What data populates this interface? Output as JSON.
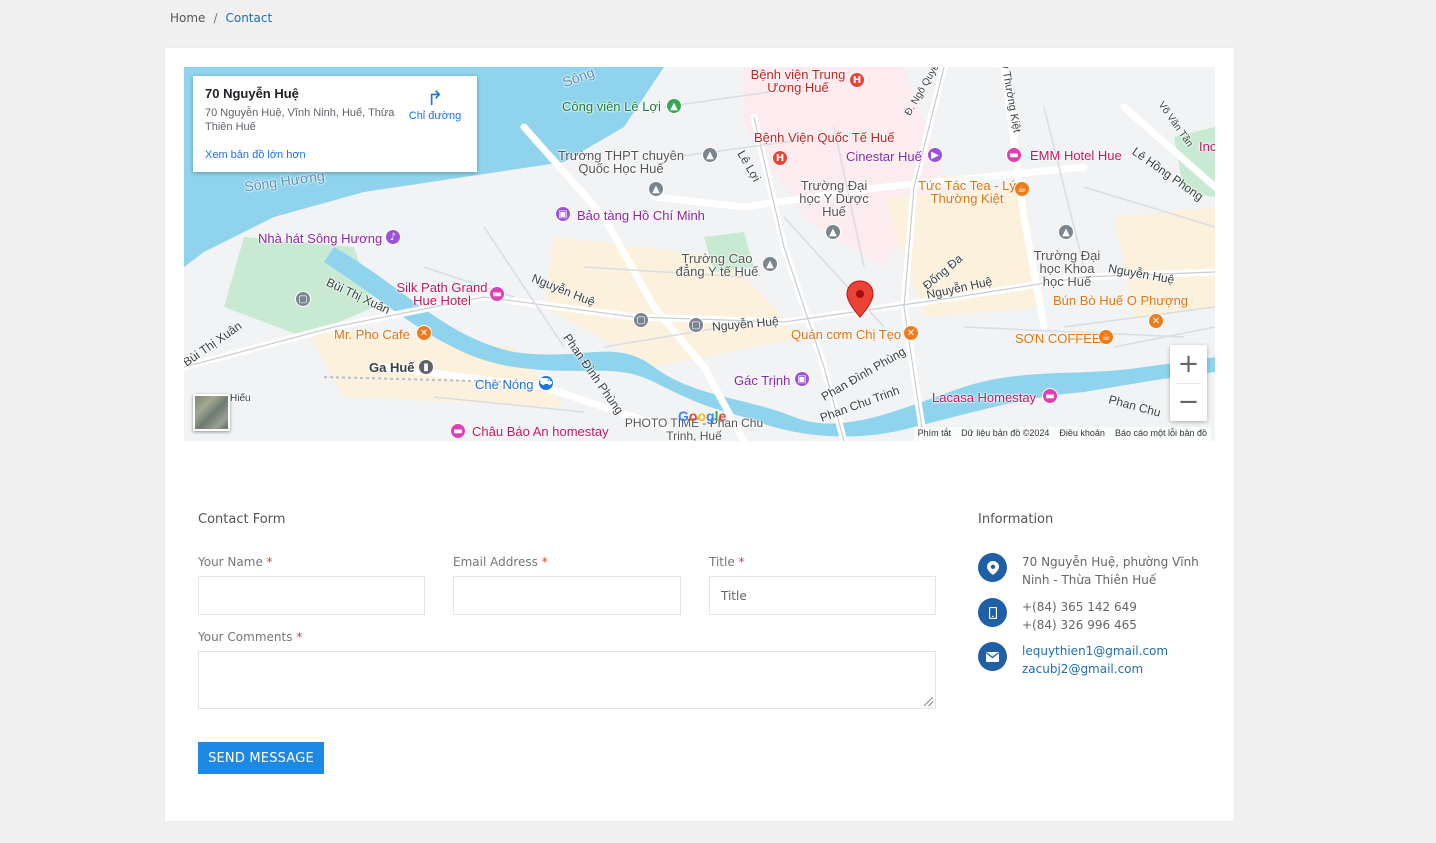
{
  "breadcrumb": {
    "home": "Home",
    "separator": "/",
    "current": "Contact"
  },
  "map": {
    "info_title": "70 Nguyễn Huệ",
    "info_address": "70 Nguyễn Huệ, Vĩnh Ninh, Huế, Thừa Thiên Huế",
    "directions_label": "Chỉ đường",
    "larger_map_label": "Xem bản đồ lớn hơn",
    "zoom_in": "+",
    "zoom_out": "−",
    "google_logo": "Google",
    "footer": {
      "shortcuts": "Phím tắt",
      "map_data": "Dữ liệu bản đồ ©2024",
      "terms": "Điều khoản",
      "report": "Báo cáo một lỗi bản đồ"
    },
    "labels": {
      "song_huong_1": "Sông",
      "song_huong_2": "Sông Hương",
      "cong_vien": "Công viên Lê Lợi",
      "benh_vien_trung_uong": "Bệnh viện Trung Ương Huế",
      "benh_vien_quoc_te": "Bệnh Viện Quốc Tế Huế",
      "thpt_quoc_hoc": "Trường THPT chuyên Quốc Học Huế",
      "le_loi": "Lê Lợi",
      "cinestar": "Cinestar Huế",
      "emm_hotel": "EMM Hotel Hue",
      "le_hong_phong": "Lê Hồng Phong",
      "vo_van_tan": "Võ Văn Tần",
      "bao_tang": "Bảo tàng Hồ Chí Minh",
      "dai_hoc_y": "Trường Đại học Y Dược Huế",
      "tuc_tac_tea": "Tức Tác Tea - Lý Thường Kiệt",
      "nha_hat": "Nhà hát Sông Hương",
      "cao_dang_y_te": "Trường Cao đẳng Y tế Huế",
      "dong_da": "Đống Đa",
      "dai_hoc_khoa_hoc": "Trường Đại học Khoa học Huế",
      "nguyen_hue_1": "Nguyễn Huệ",
      "nguyen_hue_2": "Nguyễn Huệ",
      "nguyen_hue_3": "Nguyễn Huệ",
      "nguyen_hue_4": "Nguyễn Huệ",
      "bun_bo": "Bún Bò Huế O Phượng",
      "silk_path": "Silk Path Grand Hue Hotel",
      "bui_thi_xuan_1": "Bùi Thị Xuân",
      "bui_thi_xuan_2": "Bùi Thị Xuân",
      "mr_pho": "Mr. Pho Cafe",
      "quan_com": "Quán cơm Chị Tẹo",
      "son_coffee": "SƠN COFFEE",
      "ga_hue": "Ga Huế",
      "phan_dinh_phung_1": "Phan Đình Phùng",
      "phan_dinh_phung_2": "Phan Đình Phùng",
      "che_nong": "Chè Nóng",
      "gac_trinh": "Gác Trịnh",
      "phan_chu_trinh_1": "Phan Chu Trinh",
      "phan_chu_trinh_2": "Phan Chu Trinh",
      "lacasa": "Lacasa Homestay",
      "photo_time": "PHOTO TIME - Phan Chu Trinh, Huế",
      "chau_bao_an": "Châu Báo An homestay",
      "ly_thuong_kiet": "Lý Thường Kiệt",
      "ngo_quyen": "Đ. Ngô Quyền",
      "hieu": "Hiếu",
      "inc": "Inc",
      "chu": "Phan Chu"
    }
  },
  "contact_form": {
    "title": "Contact Form",
    "name_label": "Your Name",
    "email_label": "Email Address",
    "title_label": "Title",
    "title_placeholder": "Title",
    "comments_label": "Your Comments",
    "required_mark": "*",
    "submit_label": "SEND MESSAGE"
  },
  "information": {
    "title": "Information",
    "address": "70 Nguyễn Huệ, phường Vĩnh Ninh - Thừa Thiên Huế",
    "phone_1": "+(84) 365 142 649",
    "phone_2": "+(84) 326 996 465",
    "email_1": "lequythien1@gmail.com",
    "email_2": "zacubj2@gmail.com"
  },
  "icons": {
    "location": "location-pin-icon",
    "phone": "mobile-phone-icon",
    "email": "envelope-icon",
    "directions": "directions-arrow-icon",
    "map_pin": "map-marker-icon"
  },
  "colors": {
    "accent": "#1e88e5",
    "icon_circle": "#1e5fa6",
    "link": "#1e6fb0",
    "required": "#e53935",
    "water": "#8fd4ec",
    "pin": "#ea4335"
  }
}
